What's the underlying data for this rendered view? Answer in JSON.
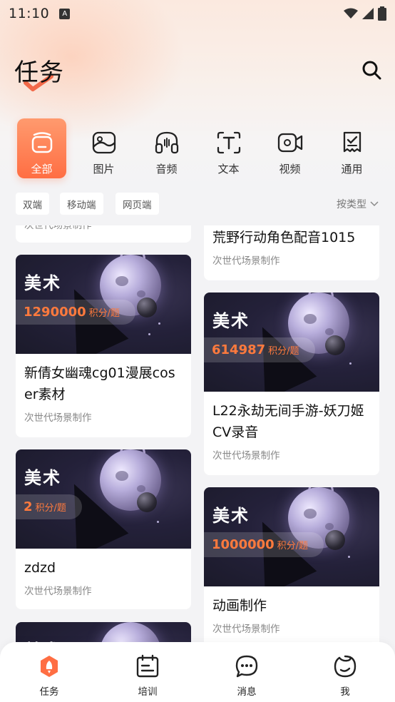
{
  "status": {
    "time": "11:10",
    "a_badge": "A"
  },
  "header": {
    "title": "任务"
  },
  "categories": [
    {
      "label": "全部",
      "icon": "all-box-icon",
      "active": true
    },
    {
      "label": "图片",
      "icon": "image-icon",
      "active": false
    },
    {
      "label": "音频",
      "icon": "audio-icon",
      "active": false
    },
    {
      "label": "文本",
      "icon": "text-icon",
      "active": false
    },
    {
      "label": "视频",
      "icon": "video-icon",
      "active": false
    },
    {
      "label": "通用",
      "icon": "general-icon",
      "active": false
    }
  ],
  "filters": {
    "chips": [
      "双端",
      "移动端",
      "网页端"
    ],
    "sort_label": "按类型"
  },
  "feed": {
    "partial_top_left_sub": "次世代场景制作",
    "cards": [
      {
        "id": "c-right-1",
        "title": "荒野行动角色配音1015",
        "sub": "次世代场景制作",
        "has_image": false
      },
      {
        "id": "c-left-1",
        "tag": "美术",
        "points": "1290000",
        "unit": "积分/题",
        "title": "新倩女幽魂cg01漫展coser素材",
        "sub": "次世代场景制作"
      },
      {
        "id": "c-right-2",
        "tag": "美术",
        "points": "614987",
        "unit": "积分/题",
        "title": "L22永劫无间手游-妖刀姬CV录音",
        "sub": "次世代场景制作"
      },
      {
        "id": "c-left-2",
        "tag": "美术",
        "points": "2",
        "unit": "积分/题",
        "title": "zdzd",
        "sub": "次世代场景制作"
      },
      {
        "id": "c-right-3",
        "tag": "美术",
        "points": "1000000",
        "unit": "积分/题",
        "title": "动画制作",
        "sub": "次世代场景制作"
      },
      {
        "id": "c-left-3",
        "tag": "美术"
      }
    ]
  },
  "tabbar": [
    {
      "label": "任务",
      "icon": "rocket-icon",
      "active": true
    },
    {
      "label": "培训",
      "icon": "calendar-icon",
      "active": false
    },
    {
      "label": "消息",
      "icon": "message-icon",
      "active": false
    },
    {
      "label": "我",
      "icon": "profile-icon",
      "active": false
    }
  ],
  "colors": {
    "accent": "#ff6e43",
    "points": "#ff7a3d"
  }
}
